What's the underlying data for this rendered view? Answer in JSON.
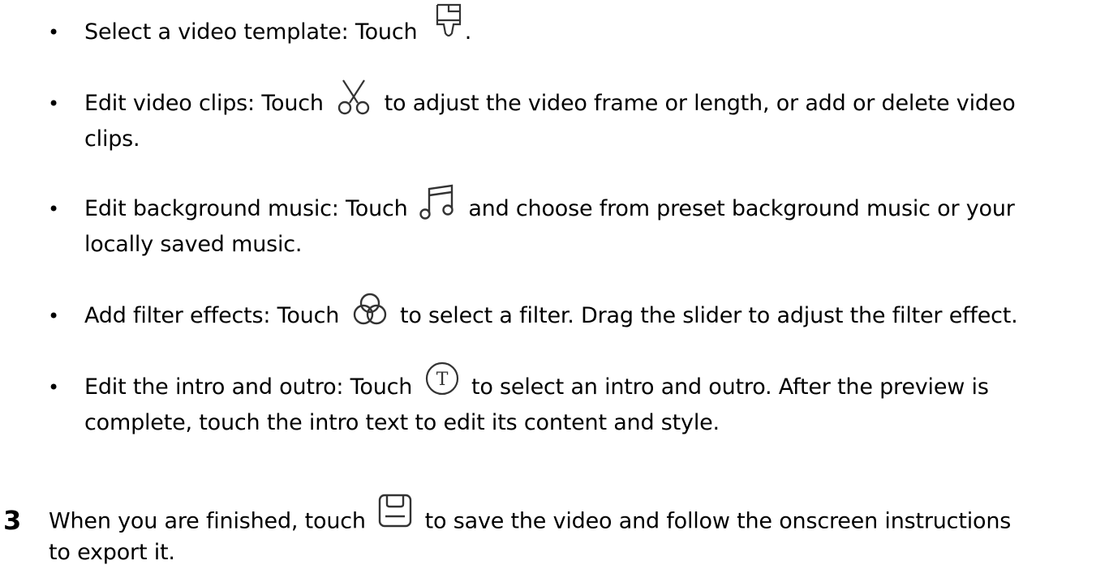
{
  "bullets": [
    {
      "bullet": "•",
      "before": "Select a video template: Touch",
      "icon": "brush-icon",
      "after": ".",
      "line2": ""
    },
    {
      "bullet": "•",
      "before": "Edit video clips: Touch",
      "icon": "scissors-icon",
      "after": "to adjust the video frame or length, or add or delete video",
      "line2": "clips."
    },
    {
      "bullet": "•",
      "before": "Edit background music: Touch",
      "icon": "music-note-icon",
      "after": "and choose from preset background music or your",
      "line2": "locally saved music."
    },
    {
      "bullet": "•",
      "before": "Add filter effects: Touch",
      "icon": "filter-circles-icon",
      "after": "to select a filter. Drag the slider to adjust the filter effect.",
      "line2": ""
    },
    {
      "bullet": "•",
      "before": "Edit the intro and outro: Touch",
      "icon": "text-t-icon",
      "after": "to select an intro and outro. After the preview is",
      "line2": "complete, touch the intro text to edit its content and style."
    }
  ],
  "step": {
    "number": "3",
    "before": "When you are finished, touch",
    "icon": "save-icon",
    "after": "to save the video and follow the onscreen instructions",
    "line2": "to export it."
  }
}
